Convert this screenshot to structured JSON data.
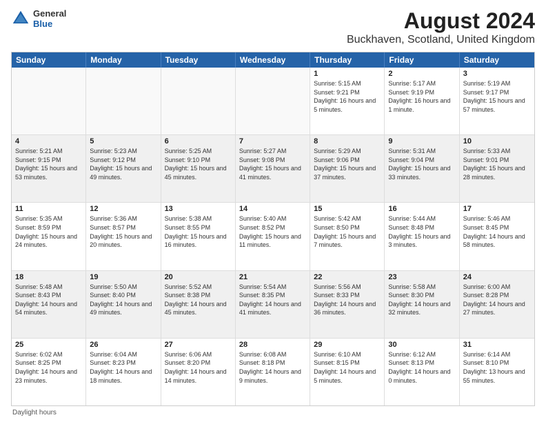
{
  "header": {
    "title": "August 2024",
    "subtitle": "Buckhaven, Scotland, United Kingdom",
    "logo_general": "General",
    "logo_blue": "Blue"
  },
  "days_of_week": [
    "Sunday",
    "Monday",
    "Tuesday",
    "Wednesday",
    "Thursday",
    "Friday",
    "Saturday"
  ],
  "footer": "Daylight hours",
  "weeks": [
    {
      "cells": [
        {
          "day": "",
          "empty": true
        },
        {
          "day": "",
          "empty": true
        },
        {
          "day": "",
          "empty": true
        },
        {
          "day": "",
          "empty": true
        },
        {
          "day": "1",
          "sunrise": "Sunrise: 5:15 AM",
          "sunset": "Sunset: 9:21 PM",
          "daylight": "Daylight: 16 hours and 5 minutes."
        },
        {
          "day": "2",
          "sunrise": "Sunrise: 5:17 AM",
          "sunset": "Sunset: 9:19 PM",
          "daylight": "Daylight: 16 hours and 1 minute."
        },
        {
          "day": "3",
          "sunrise": "Sunrise: 5:19 AM",
          "sunset": "Sunset: 9:17 PM",
          "daylight": "Daylight: 15 hours and 57 minutes."
        }
      ]
    },
    {
      "cells": [
        {
          "day": "4",
          "sunrise": "Sunrise: 5:21 AM",
          "sunset": "Sunset: 9:15 PM",
          "daylight": "Daylight: 15 hours and 53 minutes."
        },
        {
          "day": "5",
          "sunrise": "Sunrise: 5:23 AM",
          "sunset": "Sunset: 9:12 PM",
          "daylight": "Daylight: 15 hours and 49 minutes."
        },
        {
          "day": "6",
          "sunrise": "Sunrise: 5:25 AM",
          "sunset": "Sunset: 9:10 PM",
          "daylight": "Daylight: 15 hours and 45 minutes."
        },
        {
          "day": "7",
          "sunrise": "Sunrise: 5:27 AM",
          "sunset": "Sunset: 9:08 PM",
          "daylight": "Daylight: 15 hours and 41 minutes."
        },
        {
          "day": "8",
          "sunrise": "Sunrise: 5:29 AM",
          "sunset": "Sunset: 9:06 PM",
          "daylight": "Daylight: 15 hours and 37 minutes."
        },
        {
          "day": "9",
          "sunrise": "Sunrise: 5:31 AM",
          "sunset": "Sunset: 9:04 PM",
          "daylight": "Daylight: 15 hours and 33 minutes."
        },
        {
          "day": "10",
          "sunrise": "Sunrise: 5:33 AM",
          "sunset": "Sunset: 9:01 PM",
          "daylight": "Daylight: 15 hours and 28 minutes."
        }
      ]
    },
    {
      "cells": [
        {
          "day": "11",
          "sunrise": "Sunrise: 5:35 AM",
          "sunset": "Sunset: 8:59 PM",
          "daylight": "Daylight: 15 hours and 24 minutes."
        },
        {
          "day": "12",
          "sunrise": "Sunrise: 5:36 AM",
          "sunset": "Sunset: 8:57 PM",
          "daylight": "Daylight: 15 hours and 20 minutes."
        },
        {
          "day": "13",
          "sunrise": "Sunrise: 5:38 AM",
          "sunset": "Sunset: 8:55 PM",
          "daylight": "Daylight: 15 hours and 16 minutes."
        },
        {
          "day": "14",
          "sunrise": "Sunrise: 5:40 AM",
          "sunset": "Sunset: 8:52 PM",
          "daylight": "Daylight: 15 hours and 11 minutes."
        },
        {
          "day": "15",
          "sunrise": "Sunrise: 5:42 AM",
          "sunset": "Sunset: 8:50 PM",
          "daylight": "Daylight: 15 hours and 7 minutes."
        },
        {
          "day": "16",
          "sunrise": "Sunrise: 5:44 AM",
          "sunset": "Sunset: 8:48 PM",
          "daylight": "Daylight: 15 hours and 3 minutes."
        },
        {
          "day": "17",
          "sunrise": "Sunrise: 5:46 AM",
          "sunset": "Sunset: 8:45 PM",
          "daylight": "Daylight: 14 hours and 58 minutes."
        }
      ]
    },
    {
      "cells": [
        {
          "day": "18",
          "sunrise": "Sunrise: 5:48 AM",
          "sunset": "Sunset: 8:43 PM",
          "daylight": "Daylight: 14 hours and 54 minutes."
        },
        {
          "day": "19",
          "sunrise": "Sunrise: 5:50 AM",
          "sunset": "Sunset: 8:40 PM",
          "daylight": "Daylight: 14 hours and 49 minutes."
        },
        {
          "day": "20",
          "sunrise": "Sunrise: 5:52 AM",
          "sunset": "Sunset: 8:38 PM",
          "daylight": "Daylight: 14 hours and 45 minutes."
        },
        {
          "day": "21",
          "sunrise": "Sunrise: 5:54 AM",
          "sunset": "Sunset: 8:35 PM",
          "daylight": "Daylight: 14 hours and 41 minutes."
        },
        {
          "day": "22",
          "sunrise": "Sunrise: 5:56 AM",
          "sunset": "Sunset: 8:33 PM",
          "daylight": "Daylight: 14 hours and 36 minutes."
        },
        {
          "day": "23",
          "sunrise": "Sunrise: 5:58 AM",
          "sunset": "Sunset: 8:30 PM",
          "daylight": "Daylight: 14 hours and 32 minutes."
        },
        {
          "day": "24",
          "sunrise": "Sunrise: 6:00 AM",
          "sunset": "Sunset: 8:28 PM",
          "daylight": "Daylight: 14 hours and 27 minutes."
        }
      ]
    },
    {
      "cells": [
        {
          "day": "25",
          "sunrise": "Sunrise: 6:02 AM",
          "sunset": "Sunset: 8:25 PM",
          "daylight": "Daylight: 14 hours and 23 minutes."
        },
        {
          "day": "26",
          "sunrise": "Sunrise: 6:04 AM",
          "sunset": "Sunset: 8:23 PM",
          "daylight": "Daylight: 14 hours and 18 minutes."
        },
        {
          "day": "27",
          "sunrise": "Sunrise: 6:06 AM",
          "sunset": "Sunset: 8:20 PM",
          "daylight": "Daylight: 14 hours and 14 minutes."
        },
        {
          "day": "28",
          "sunrise": "Sunrise: 6:08 AM",
          "sunset": "Sunset: 8:18 PM",
          "daylight": "Daylight: 14 hours and 9 minutes."
        },
        {
          "day": "29",
          "sunrise": "Sunrise: 6:10 AM",
          "sunset": "Sunset: 8:15 PM",
          "daylight": "Daylight: 14 hours and 5 minutes."
        },
        {
          "day": "30",
          "sunrise": "Sunrise: 6:12 AM",
          "sunset": "Sunset: 8:13 PM",
          "daylight": "Daylight: 14 hours and 0 minutes."
        },
        {
          "day": "31",
          "sunrise": "Sunrise: 6:14 AM",
          "sunset": "Sunset: 8:10 PM",
          "daylight": "Daylight: 13 hours and 55 minutes."
        }
      ]
    }
  ]
}
